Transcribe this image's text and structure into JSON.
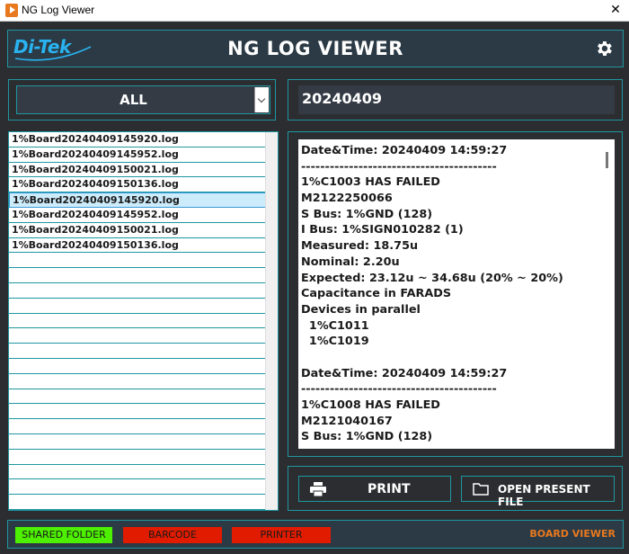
{
  "window": {
    "title": "NG Log Viewer",
    "close_glyph": "✕"
  },
  "header": {
    "logo_text": "Di-Tek",
    "title": "NG LOG VIEWER",
    "settings_icon": "gear-icon"
  },
  "filter": {
    "selected": "ALL"
  },
  "date_field": {
    "value": "20240409"
  },
  "files": [
    "1%Board20240409145920.log",
    "1%Board20240409145952.log",
    "1%Board20240409150021.log",
    "1%Board20240409150136.log",
    "1%Board20240409145920.log",
    "1%Board20240409145952.log",
    "1%Board20240409150021.log",
    "1%Board20240409150136.log"
  ],
  "selected_file_index": 4,
  "log_lines": [
    "Date&Time: 20240409 14:59:27",
    "-----------------------------------------",
    "1%C1003 HAS FAILED",
    "M2122250066",
    "S Bus: 1%GND (128)",
    "I Bus: 1%SIGN010282 (1)",
    "Measured: 18.75u",
    "Nominal: 2.20u",
    "Expected: 23.12u ~ 34.68u (20% ~ 20%)",
    "Capacitance in FARADS",
    "Devices in parallel",
    "  1%C1011",
    "  1%C1019",
    "",
    "Date&Time: 20240409 14:59:27",
    "-----------------------------------------",
    "1%C1008 HAS FAILED",
    "M2121040167",
    "S Bus: 1%GND (128)"
  ],
  "buttons": {
    "print": "PRINT",
    "open": "OPEN PRESENT FILE"
  },
  "status": {
    "shared_folder": "SHARED FOLDER",
    "barcode": "BARCODE",
    "printer": "PRINTER",
    "board_viewer": "BOARD VIEWER"
  },
  "colors": {
    "accent": "#1f97a0",
    "ok": "#4cf000",
    "error": "#e01b00",
    "orange": "#e8791f"
  }
}
